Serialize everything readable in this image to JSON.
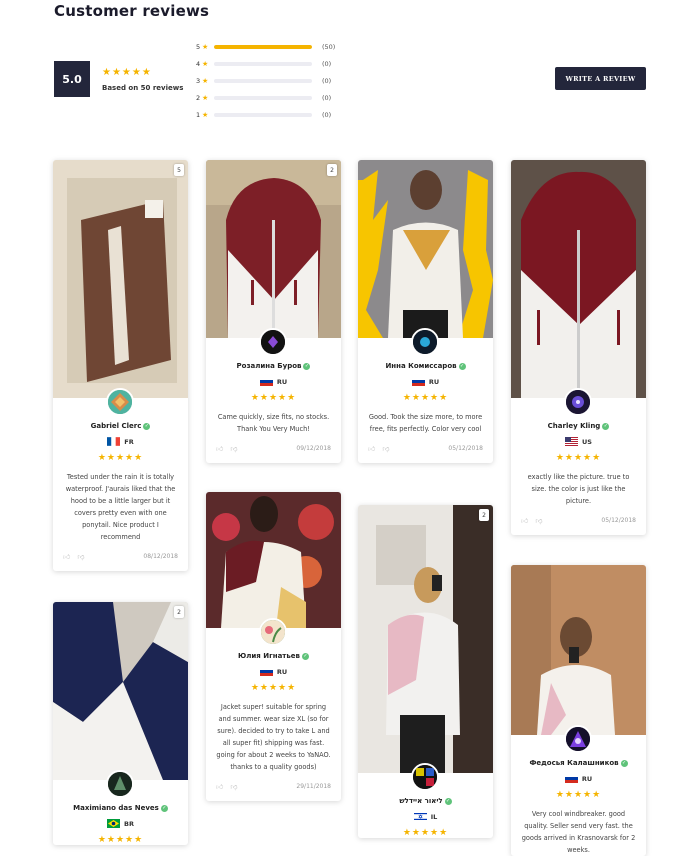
{
  "header": {
    "title": "Customer reviews"
  },
  "summary": {
    "average": "5.0",
    "stars": "★★★★★",
    "based_on": "Based on 50 reviews",
    "distribution": [
      {
        "stars": "5",
        "count": "(50)",
        "fraction": 1.0
      },
      {
        "stars": "4",
        "count": "(0)",
        "fraction": 0
      },
      {
        "stars": "3",
        "count": "(0)",
        "fraction": 0
      },
      {
        "stars": "2",
        "count": "(0)",
        "fraction": 0
      },
      {
        "stars": "1",
        "count": "(0)",
        "fraction": 0
      }
    ],
    "star_glyph": "★",
    "write_review_label": "WRITE A REVIEW"
  },
  "reviews": [
    {
      "name": "Gabriel Clerc",
      "country": "FR",
      "stars": "★★★★★",
      "photo_count": "5",
      "text": "Tested under the rain it is totally waterproof. J'aurais liked that the hood to be a little larger but it covers pretty even with one ponytail. Nice product I recommend",
      "date": "08/12/2018"
    },
    {
      "name": "Розалина Буров",
      "country": "RU",
      "stars": "★★★★★",
      "photo_count": "2",
      "text": "Came quickly, size fits, no stocks. Thank You Very Much!",
      "date": "09/12/2018"
    },
    {
      "name": "Инна Комиссаров",
      "country": "RU",
      "stars": "★★★★★",
      "photo_count": "",
      "text": "Good. Took the size more, to more free, fits perfectly. Color very cool",
      "date": "05/12/2018"
    },
    {
      "name": "Charley Kling",
      "country": "US",
      "stars": "★★★★★",
      "photo_count": "",
      "text": "exactly like the picture. true to size. the color is just like the picture.",
      "date": "05/12/2018"
    },
    {
      "name": "Maximiano das Neves",
      "country": "BR",
      "stars": "★★★★★",
      "photo_count": "2",
      "text": "",
      "date": ""
    },
    {
      "name": "Юлия Игнатьев",
      "country": "RU",
      "stars": "★★★★★",
      "photo_count": "",
      "text": "Jacket super! suitable for spring and summer. wear size XL (so for sure). decided to try to take L and all super fit) shipping was fast. going for about 2 weeks to YaNAO. thanks to a quality goods)",
      "date": "29/11/2018"
    },
    {
      "name": "ליאור איידלש",
      "country": "IL",
      "stars": "★★★★★",
      "photo_count": "2",
      "text": "",
      "date": ""
    },
    {
      "name": "Федосья Калашников",
      "country": "RU",
      "stars": "★★★★★",
      "photo_count": "",
      "text": "Very cool windbreaker. good quality. Seller send very fast. the goods arrived in Krasnovarsk for 2 weeks.",
      "date": ""
    }
  ],
  "icons": {
    "like": "thumbs-up-icon",
    "dislike": "thumbs-down-icon",
    "verified": "check-icon"
  },
  "colors": {
    "accent": "#f5b400",
    "dark": "#23263b",
    "verified": "#5fc37a"
  }
}
